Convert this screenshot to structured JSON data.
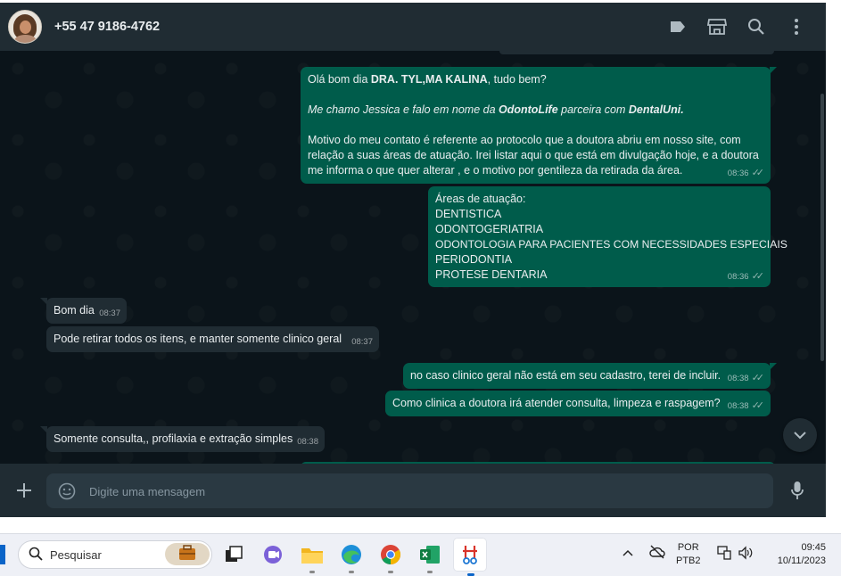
{
  "header": {
    "contact_name": "+55 47 9186-4762"
  },
  "messages": {
    "m1": {
      "line1_prefix": "Olá bom dia ",
      "line1_bold": "DRA. TYL,MA KALINA",
      "line1_suffix": ", tudo bem?",
      "line2_a": "Me chamo Jessica e falo em nome da ",
      "line2_b": "OdontoLife",
      "line2_c": " parceira com ",
      "line2_d": "DentalUni.",
      "line3": "Motivo do meu contato é referente ao protocolo que a doutora abriu em nosso site, com relação a suas áreas de atuação. Irei listar aqui o que está em divulgação hoje, e a doutora me informa o que quer alterar , e o motivo por gentileza da retirada da área.",
      "time": "08:36"
    },
    "m2": {
      "title": "Áreas de atuação:",
      "items": [
        "DENTISTICA",
        "ODONTOGERIATRIA",
        "ODONTOLOGIA PARA PACIENTES COM NECESSIDADES ESPECIAIS",
        "PERIODONTIA",
        "PROTESE DENTARIA"
      ],
      "time": "08:36"
    },
    "m3": {
      "text": "Bom dia",
      "time": "08:37"
    },
    "m4": {
      "text": "Pode retirar todos os itens, e manter somente clinico geral",
      "time": "08:37"
    },
    "m5": {
      "text": "no caso clinico geral não está em seu cadastro, terei de incluir.",
      "time": "08:38"
    },
    "m6": {
      "text": "Como clinica a doutora irá atender consulta, limpeza e raspagem?",
      "time": "08:38"
    },
    "m7": {
      "text": "Somente consulta,, profilaxia e extração simples",
      "time": "08:38"
    }
  },
  "composer": {
    "placeholder": "Digite uma mensagem"
  },
  "taskbar": {
    "search_label": "Pesquisar",
    "lang_line1": "POR",
    "lang_line2": "PTB2",
    "time": "09:45",
    "date": "10/11/2023"
  },
  "icons": {
    "header": [
      "label-icon",
      "store-icon",
      "search-icon",
      "menu-dots-icon"
    ],
    "composer": [
      "plus-icon",
      "emoji-icon",
      "microphone-icon"
    ]
  },
  "colors": {
    "outgoing_bubble": "#005c4b",
    "incoming_bubble": "#202c33",
    "chat_background": "#0b141a",
    "header_background": "#202c33"
  }
}
